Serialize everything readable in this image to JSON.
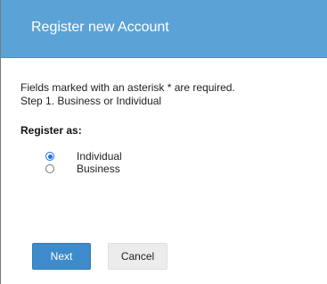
{
  "dialog": {
    "title": "Register new Account",
    "intro_line1": "Fields marked with an asterisk * are required.",
    "intro_line2": "Step 1. Business or Individual",
    "register_as_label": "Register as:",
    "options": [
      {
        "label": "Individual",
        "selected": true
      },
      {
        "label": "Business",
        "selected": false
      }
    ],
    "next_label": "Next",
    "cancel_label": "Cancel"
  },
  "colors": {
    "header": "#5ba3d6",
    "primary_button": "#3e8bcb",
    "secondary_button": "#ececec"
  },
  "icons": [
    "radio-selected-icon",
    "radio-unselected-icon"
  ]
}
